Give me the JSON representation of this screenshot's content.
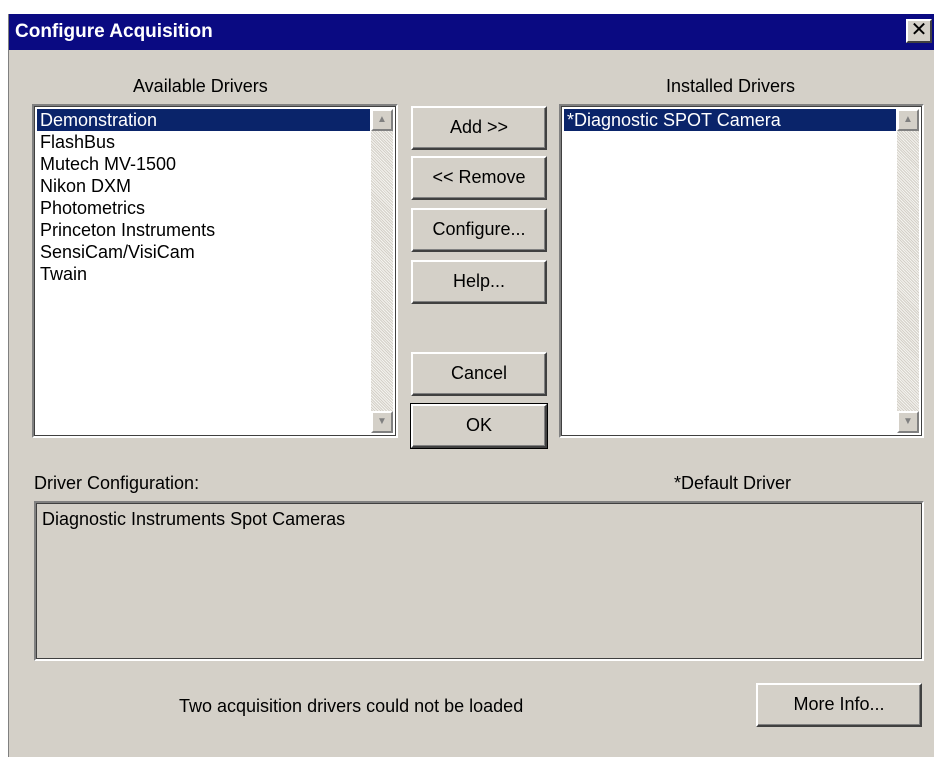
{
  "window": {
    "title": "Configure Acquisition",
    "close_glyph": "✕"
  },
  "available": {
    "label": "Available Drivers",
    "items": [
      "Demonstration",
      "FlashBus",
      "Mutech MV-1500",
      "Nikon DXM",
      "Photometrics",
      "Princeton Instruments",
      "SensiCam/VisiCam",
      "Twain"
    ],
    "selected": "Demonstration"
  },
  "installed": {
    "label": "Installed Drivers",
    "items": [
      "*Diagnostic SPOT Camera"
    ],
    "selected": "*Diagnostic SPOT Camera"
  },
  "buttons": {
    "add": "Add >>",
    "remove": "<< Remove",
    "configure": "Configure...",
    "help": "Help...",
    "cancel": "Cancel",
    "ok": "OK",
    "more_info": "More Info..."
  },
  "config": {
    "label": "Driver Configuration:",
    "default_note": "*Default Driver",
    "text": "Diagnostic Instruments Spot Cameras"
  },
  "status": {
    "message": "Two acquisition drivers could not be loaded"
  },
  "icons": {
    "scroll_up": "▲",
    "scroll_down": "▼"
  }
}
